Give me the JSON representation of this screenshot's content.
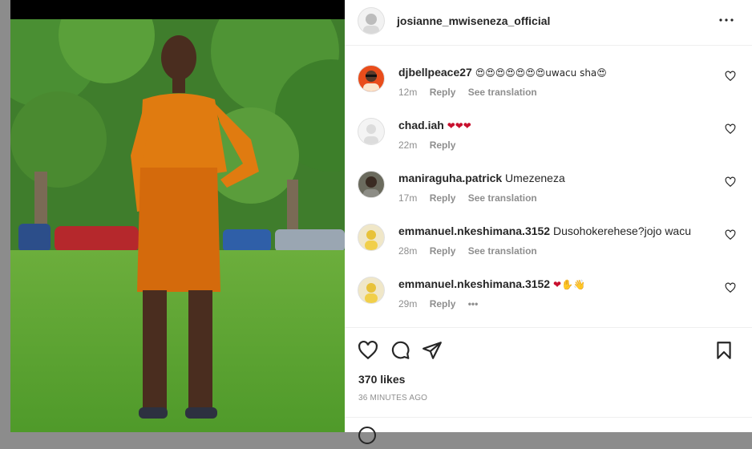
{
  "post": {
    "username": "josianne_mwiseneza_official",
    "likes": "370 likes",
    "time": "36 MINUTES AGO"
  },
  "comments": [
    {
      "user": "djbellpeace27",
      "text": "😍😍😍😍😍😍😍uwacu sha😍",
      "age": "12m",
      "reply": "Reply",
      "translate": "See translation"
    },
    {
      "user": "chad.iah",
      "text": "❤❤❤",
      "age": "22m",
      "reply": "Reply",
      "translate": ""
    },
    {
      "user": "maniraguha.patrick",
      "text": "Umezeneza",
      "age": "17m",
      "reply": "Reply",
      "translate": "See translation"
    },
    {
      "user": "emmanuel.nkeshimana.3152",
      "text": "Dusohokerehese?jojo wacu",
      "age": "28m",
      "reply": "Reply",
      "translate": "See translation"
    },
    {
      "user": "emmanuel.nkeshimana.3152",
      "text": "❤✋👋",
      "age": "29m",
      "reply": "Reply",
      "translate": "•••"
    }
  ],
  "icons": {
    "more": "more-options-icon",
    "like": "heart-icon",
    "comment": "comment-icon",
    "share": "share-icon",
    "save": "bookmark-icon"
  },
  "colors": {
    "heart_red": "#c8102e",
    "meta_gray": "#8e8e8e",
    "dress_orange": "#e07b10"
  }
}
